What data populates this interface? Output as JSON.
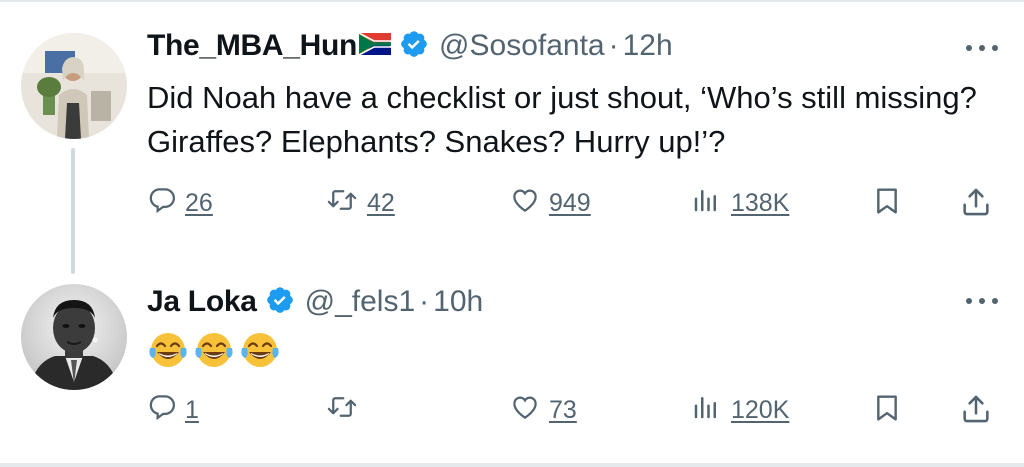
{
  "tweets": [
    {
      "author": {
        "name": "The_MBA_Hun",
        "handle": "@Sosofanta",
        "time": "12h",
        "verified": true,
        "flag": "south-africa-flag-icon"
      },
      "text": "Did Noah have a checklist or just shout, ‘Who’s still missing? Giraffes? Elephants? Snakes? Hurry up!’?",
      "stats": {
        "replies": "26",
        "retweets": "42",
        "likes": "949",
        "views": "138K"
      }
    },
    {
      "author": {
        "name": "Ja Loka",
        "handle": "@_fels1",
        "time": "10h",
        "verified": true
      },
      "emojis": [
        "tears-of-joy-emoji",
        "tears-of-joy-emoji",
        "tears-of-joy-emoji"
      ],
      "stats": {
        "replies": "1",
        "retweets": "",
        "likes": "73",
        "views": "120K"
      }
    }
  ],
  "colors": {
    "text": "#0f1419",
    "secondary": "#536471",
    "verified": "#1d9bf0",
    "thread_line": "#cfd9de"
  },
  "icons": [
    "reply-icon",
    "retweet-icon",
    "like-icon",
    "views-icon",
    "bookmark-icon",
    "share-icon",
    "more-icon",
    "verified-icon"
  ]
}
